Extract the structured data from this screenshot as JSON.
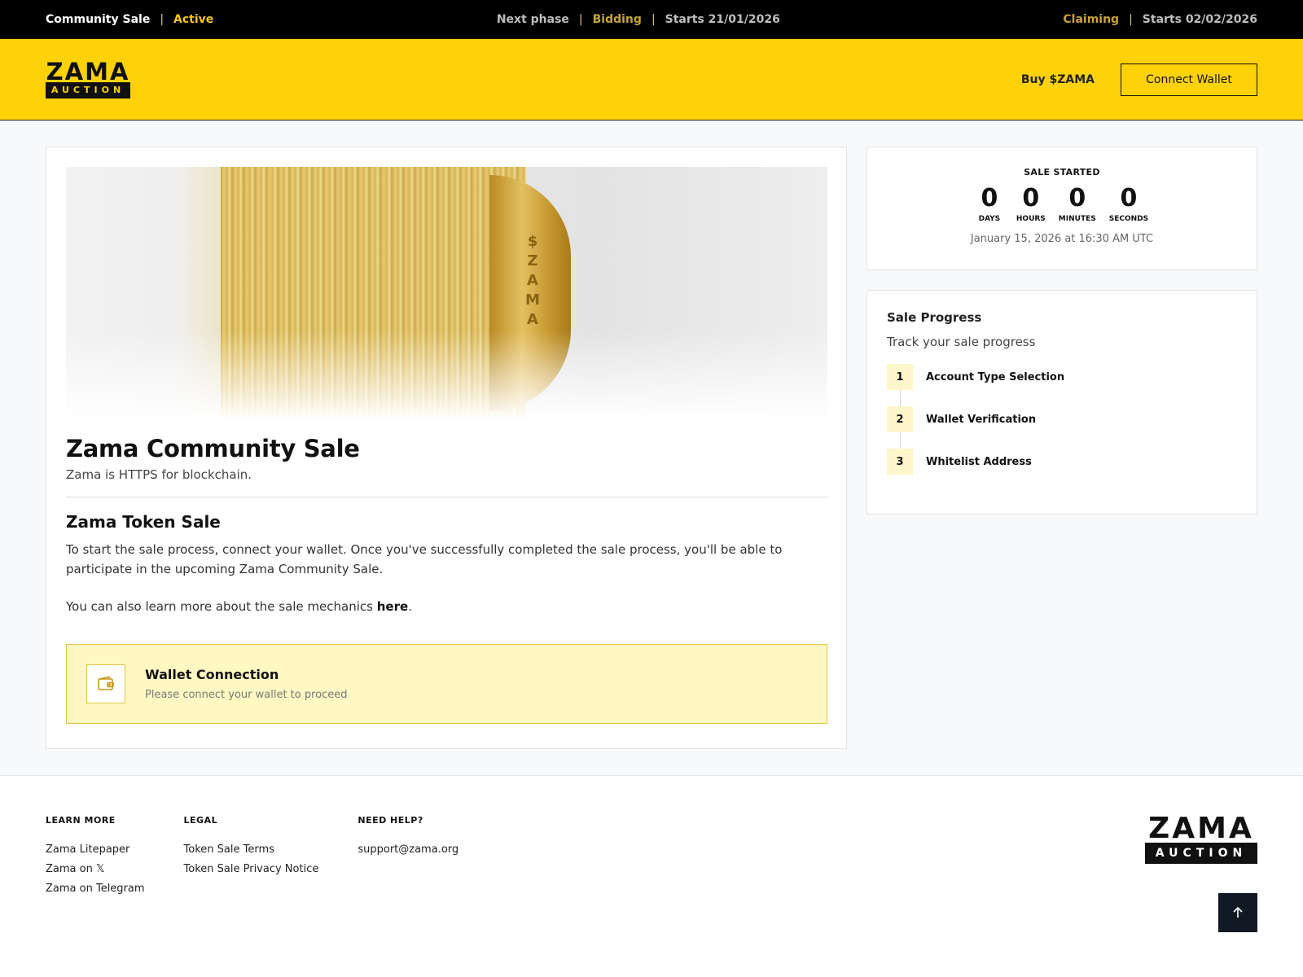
{
  "topbar": {
    "sale_name": "Community Sale",
    "sale_status": "Active",
    "next_phase_label": "Next phase",
    "phase_bidding": "Bidding",
    "bidding_start": "Starts 21/01/2026",
    "phase_claiming": "Claiming",
    "claiming_start": "Starts 02/02/2026",
    "separator": "|"
  },
  "header": {
    "logo_word": "ZAMA",
    "logo_sub": "AUCTION",
    "buy_label": "Buy $ZAMA",
    "connect_label": "Connect Wallet"
  },
  "main": {
    "hero_coin_text": "$ Z A M A",
    "title": "Zama Community Sale",
    "subtitle": "Zama is HTTPS for blockchain.",
    "token_title": "Zama Token Sale",
    "paragraph": "To start the sale process, connect your wallet. Once you've successfully completed the sale process, you'll be able to participate in the upcoming Zama Community Sale.",
    "learn_prefix": "You can also learn more about the sale mechanics ",
    "learn_link": "here",
    "learn_suffix": ".",
    "wallet": {
      "title": "Wallet Connection",
      "desc": "Please connect your wallet to proceed",
      "icon": "wallet-icon"
    }
  },
  "timer": {
    "label": "SALE STARTED",
    "days": "0",
    "days_label": "DAYS",
    "hours": "0",
    "hours_label": "HOURS",
    "minutes": "0",
    "minutes_label": "MINUTES",
    "seconds": "0",
    "seconds_label": "SECONDS",
    "date": "January 15, 2026 at 16:30 AM UTC"
  },
  "progress": {
    "title": "Sale Progress",
    "subtitle": "Track your sale progress",
    "steps": [
      {
        "num": "1",
        "label": "Account Type Selection"
      },
      {
        "num": "2",
        "label": "Wallet Verification"
      },
      {
        "num": "3",
        "label": "Whitelist Address"
      }
    ]
  },
  "footer": {
    "learn": {
      "heading": "LEARN MORE",
      "links": [
        "Zama Litepaper",
        "Zama on 𝕏",
        "Zama on Telegram"
      ]
    },
    "legal": {
      "heading": "LEGAL",
      "links": [
        "Token Sale Terms",
        "Token Sale Privacy Notice"
      ]
    },
    "help": {
      "heading": "NEED HELP?",
      "links": [
        "support@zama.org"
      ]
    },
    "logo_word": "ZAMA",
    "logo_sub": "AUCTION"
  },
  "colors": {
    "brand_yellow": "#ffd208",
    "topbar_bg": "#000000",
    "active_gold": "#f5c518"
  }
}
